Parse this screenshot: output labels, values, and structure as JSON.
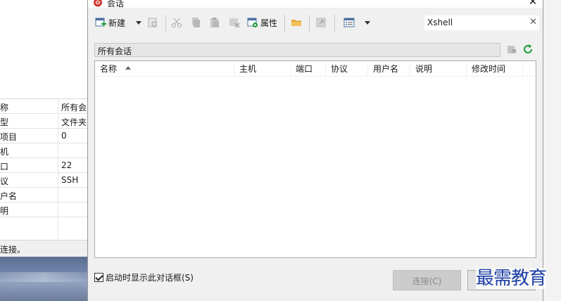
{
  "background_window": {
    "properties": [
      {
        "key": "称",
        "value": "所有会"
      },
      {
        "key": "型",
        "value": "文件夹"
      },
      {
        "key": "项目",
        "value": "0"
      },
      {
        "key": "机",
        "value": ""
      },
      {
        "key": "口",
        "value": "22"
      },
      {
        "key": "议",
        "value": "SSH"
      },
      {
        "key": "户名",
        "value": ""
      },
      {
        "key": "明",
        "value": ""
      },
      {
        "key": "",
        "value": ""
      }
    ],
    "status_text": "连接。"
  },
  "dialog": {
    "title": "会话",
    "close_glyph": "✕",
    "toolbar": {
      "new_label": "新建",
      "properties_label": "属性"
    },
    "search": {
      "value": "Xshell",
      "clear_glyph": "✕"
    },
    "path": "所有会话",
    "columns": [
      "名称",
      "主机",
      "端口",
      "协议",
      "用户名",
      "说明",
      "修改时间"
    ],
    "startup_checkbox": {
      "label": "启动时显示此对话框(S)",
      "checked": true
    },
    "connect_button": "连接(C)"
  },
  "watermark": "最需教育",
  "colors": {
    "accent_red": "#d0342c",
    "refresh_green": "#1f9d3a",
    "watermark_blue": "#1e3fa8"
  }
}
